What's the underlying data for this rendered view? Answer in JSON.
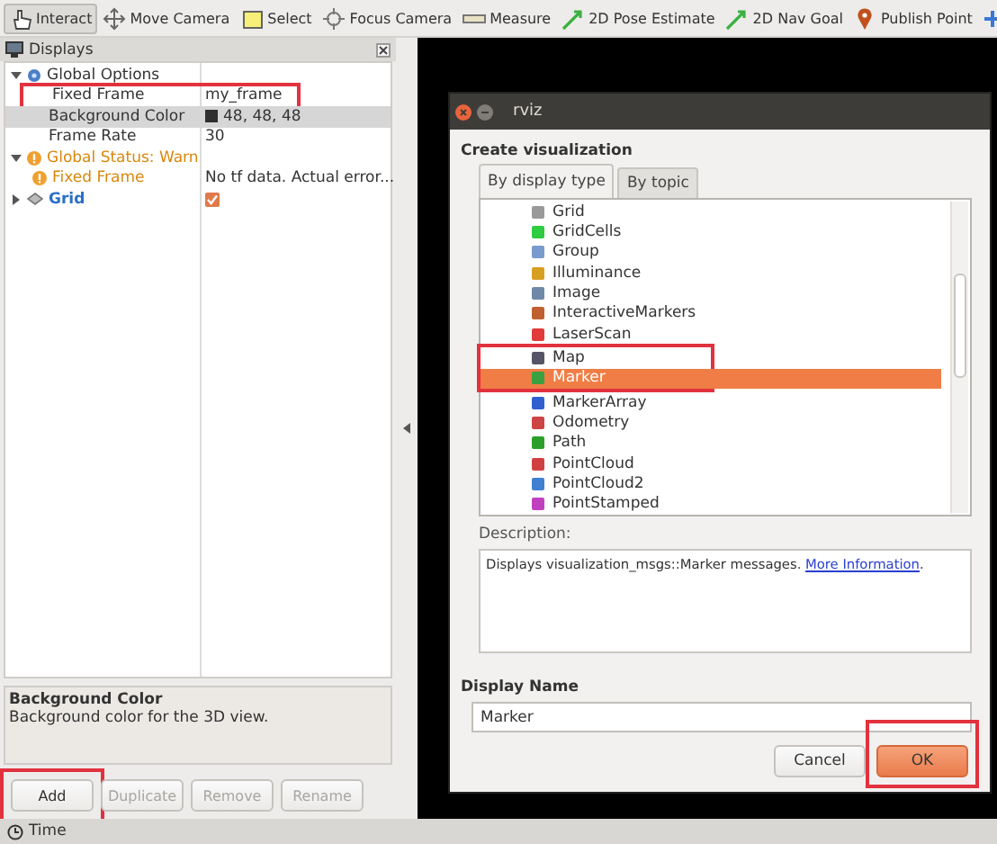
{
  "toolbar": {
    "tools": [
      {
        "label": "Interact",
        "selected": true
      },
      {
        "label": "Move Camera",
        "selected": false
      },
      {
        "label": "Select",
        "selected": false
      },
      {
        "label": "Focus Camera",
        "selected": false
      },
      {
        "label": "Measure",
        "selected": false
      },
      {
        "label": "2D Pose Estimate",
        "selected": false
      },
      {
        "label": "2D Nav Goal",
        "selected": false
      },
      {
        "label": "Publish Point",
        "selected": false
      }
    ]
  },
  "displays_panel": {
    "title": "Displays",
    "tree": [
      {
        "label": "Global Options",
        "kind": "options",
        "expanded": true,
        "selected": false,
        "highlighted": false,
        "children": [
          {
            "label": "Fixed Frame",
            "kind": "property",
            "value": "my_frame",
            "selected": false,
            "highlighted": true
          },
          {
            "label": "Background Color",
            "kind": "color",
            "value": "48, 48, 48",
            "selected": true,
            "highlighted": false
          },
          {
            "label": "Frame Rate",
            "kind": "property",
            "value": "30",
            "selected": false,
            "highlighted": false
          }
        ]
      },
      {
        "label": "Global Status: Warn",
        "kind": "warn",
        "expanded": true,
        "selected": false,
        "highlighted": false,
        "children": [
          {
            "label": "Fixed Frame",
            "kind": "warn",
            "value": "No tf data.  Actual error...",
            "selected": false,
            "highlighted": false
          }
        ]
      },
      {
        "label": "Grid",
        "kind": "display",
        "expanded": false,
        "checked": true,
        "selected": false,
        "highlighted": false
      }
    ],
    "description": {
      "title": "Background Color",
      "text": "Background color for the 3D view."
    },
    "buttons": [
      {
        "label": "Add",
        "disabled": false,
        "highlighted": true
      },
      {
        "label": "Duplicate",
        "disabled": true,
        "highlighted": false
      },
      {
        "label": "Remove",
        "disabled": true,
        "highlighted": false
      },
      {
        "label": "Rename",
        "disabled": true,
        "highlighted": false
      }
    ]
  },
  "dialog": {
    "title": "rviz",
    "heading": "Create visualization",
    "tabs": [
      {
        "label": "By display type",
        "selected": true
      },
      {
        "label": "By topic",
        "selected": false
      }
    ],
    "items": [
      {
        "label": "Grid",
        "selected": false,
        "highlighted": false
      },
      {
        "label": "GridCells",
        "selected": false,
        "highlighted": false
      },
      {
        "label": "Group",
        "selected": false,
        "highlighted": false
      },
      {
        "label": "Illuminance",
        "selected": false,
        "highlighted": false
      },
      {
        "label": "Image",
        "selected": false,
        "highlighted": false
      },
      {
        "label": "InteractiveMarkers",
        "selected": false,
        "highlighted": false
      },
      {
        "label": "LaserScan",
        "selected": false,
        "highlighted": false
      },
      {
        "label": "Map",
        "selected": false,
        "highlighted": true
      },
      {
        "label": "Marker",
        "selected": true,
        "highlighted": true
      },
      {
        "label": "MarkerArray",
        "selected": false,
        "highlighted": false
      },
      {
        "label": "Odometry",
        "selected": false,
        "highlighted": false
      },
      {
        "label": "Path",
        "selected": false,
        "highlighted": false
      },
      {
        "label": "PointCloud",
        "selected": false,
        "highlighted": false
      },
      {
        "label": "PointCloud2",
        "selected": false,
        "highlighted": false
      },
      {
        "label": "PointStamped",
        "selected": false,
        "highlighted": false
      }
    ],
    "description_label": "Description:",
    "description": "Displays visualization_msgs::Marker messages. ",
    "link": "More Information",
    "description_end": ".",
    "name_label": "Display Name",
    "name_value": "Marker",
    "buttons": [
      {
        "label": "Cancel",
        "default": false,
        "highlighted": false
      },
      {
        "label": "OK",
        "default": true,
        "highlighted": true
      }
    ]
  },
  "status_bar": {
    "label": "Time"
  }
}
